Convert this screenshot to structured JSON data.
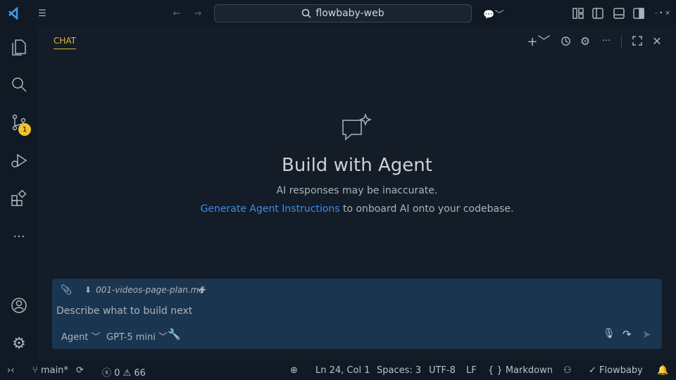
{
  "titlebar": {
    "search_text": "flowbaby-web"
  },
  "activity_bar": {
    "scm_badge": "1"
  },
  "panel": {
    "tab_label": "CHAT"
  },
  "welcome": {
    "title": "Build with Agent",
    "disclaimer": "AI responses may be inaccurate.",
    "link_text": "Generate Agent Instructions",
    "link_suffix": " to onboard AI onto your codebase."
  },
  "input": {
    "attachment": "001-videos-page-plan.md",
    "placeholder": "Describe what to build next",
    "mode": "Agent",
    "model": "GPT-5 mini"
  },
  "status_bar": {
    "branch": "main*",
    "errors": "0",
    "warnings": "66",
    "position": "Ln 24, Col 1",
    "spaces": "Spaces: 3",
    "encoding": "UTF-8",
    "eol": "LF",
    "language": "Markdown",
    "extension": "Flowbaby"
  },
  "colors": {
    "accent": "#e2b93d",
    "link": "#3b8eea",
    "badge": "#f2c12e"
  }
}
